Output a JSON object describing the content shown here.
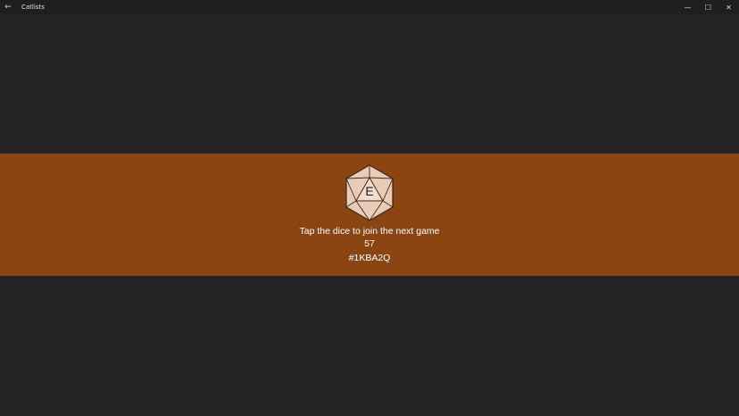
{
  "window": {
    "title": "Catlists",
    "back_glyph": "←",
    "minimize_glyph": "—",
    "maximize_glyph": "☐",
    "close_glyph": "✕"
  },
  "banner": {
    "background_color": "#8b4513",
    "dice_letter": "E",
    "dice_icon": "d20-icon",
    "message": "Tap the dice to join the next game",
    "count": "57",
    "game_code": "#1KBA2Q"
  }
}
